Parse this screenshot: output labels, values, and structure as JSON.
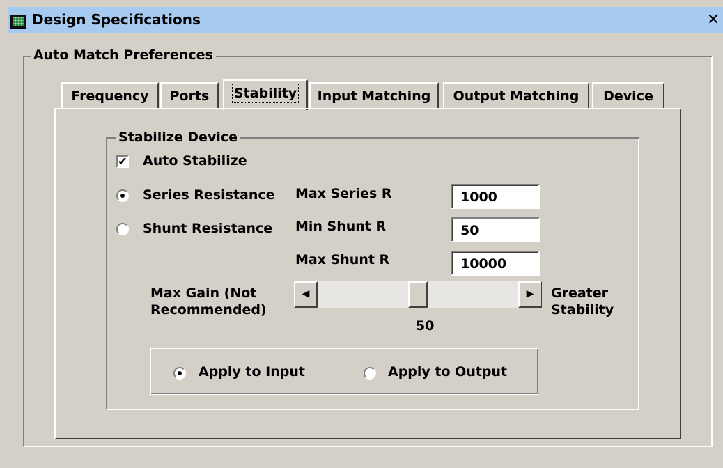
{
  "window": {
    "title": "Design Specifications",
    "close_glyph": "✕",
    "icon": "app-monitor-icon"
  },
  "auto_match": {
    "legend": "Auto Match Preferences"
  },
  "tabs": [
    {
      "label": "Frequency",
      "active": false
    },
    {
      "label": "Ports",
      "active": false
    },
    {
      "label": "Stability",
      "active": true
    },
    {
      "label": "Input Matching",
      "active": false
    },
    {
      "label": "Output Matching",
      "active": false
    },
    {
      "label": "Device",
      "active": false
    }
  ],
  "stabilize": {
    "legend": "Stabilize Device",
    "auto_stabilize_label": "Auto Stabilize",
    "auto_stabilize_checked": true,
    "series_resistance_label": "Series Resistance",
    "shunt_resistance_label": "Shunt Resistance",
    "selected_mode": "Series Resistance",
    "max_series_r_label": "Max Series R",
    "max_series_r_value": "1000",
    "min_shunt_r_label": "Min Shunt R",
    "min_shunt_r_value": "50",
    "max_shunt_r_label": "Max Shunt R",
    "max_shunt_r_value": "10000"
  },
  "slider": {
    "left_label_line1": "Max Gain (Not",
    "left_label_line2": "Recommended)",
    "right_label_line1": "Greater",
    "right_label_line2": "Stability",
    "value": "50",
    "value_fraction": 0.5,
    "left_arrow": "◀",
    "right_arrow": "▶"
  },
  "apply": {
    "input_label": "Apply to Input",
    "output_label": "Apply to Output",
    "selected": "Apply to Input"
  },
  "check_glyph": "✔"
}
